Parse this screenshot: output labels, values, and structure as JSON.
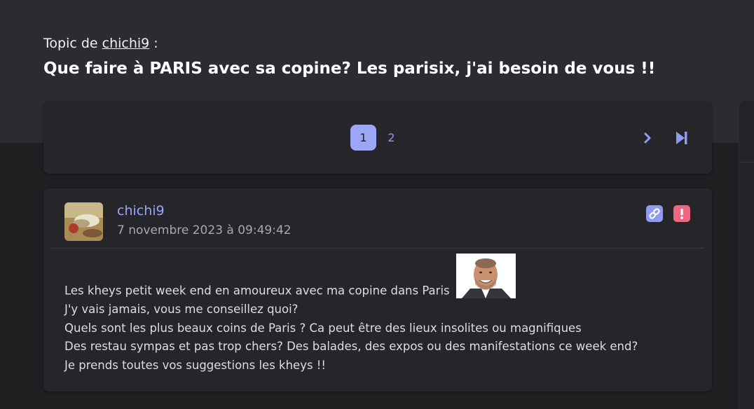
{
  "topic": {
    "prefix": "Topic de",
    "author": "chichi9",
    "suffix": ":",
    "title": "Que faire à PARIS avec sa copine? Les parisix, j'ai besoin de vous !!"
  },
  "pagination": {
    "pages": [
      "1",
      "2"
    ],
    "active_page": "1",
    "next_icon": "chevron-right-icon",
    "last_icon": "skip-to-last-icon",
    "accent": "#9da5f5"
  },
  "post": {
    "author": "chichi9",
    "date": "7 novembre 2023 à 09:49:42",
    "link_icon": "link-icon",
    "report_icon": "exclamation-icon",
    "lines": [
      "Les kheys petit week end en amoureux avec ma copine dans Paris",
      "J'y vais jamais, vous me conseillez quoi?",
      "Quels sont les plus beaux coins de Paris ? Ca peut être des lieux insolites ou magnifiques",
      "Des restau sympas et pas trop chers? Des balades, des expos ou des manifestations ce week end?",
      "Je prends toutes vos suggestions les kheys !!"
    ],
    "colors": {
      "author": "#9aa6f7",
      "report": "#f06580",
      "link": "#8f9bf3"
    }
  }
}
